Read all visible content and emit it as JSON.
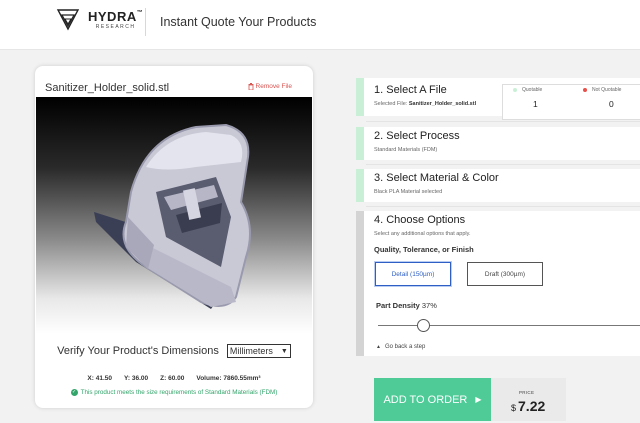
{
  "header": {
    "logo_main": "HYDRA",
    "logo_tm": "™",
    "logo_sub": "RESEARCH",
    "title": "Instant Quote Your Products"
  },
  "file_card": {
    "file_name": "Sanitizer_Holder_solid.stl",
    "remove_label": "Remove File",
    "verify_label": "Verify Your Product's Dimensions",
    "units_selected": "Millimeters",
    "dims": {
      "x_label": "X:",
      "x_value": "41.50",
      "y_label": "Y:",
      "y_value": "36.00",
      "z_label": "Z:",
      "z_value": "60.00",
      "volume_label": "Volume:",
      "volume_value": "7860.55mm³"
    },
    "size_ok_text": "This product meets the size requirements of Standard Materials (FDM)"
  },
  "steps": {
    "step1": {
      "title": "1. Select A File",
      "sub_prefix": "Selected File: ",
      "sub_value": "Sanitizer_Holder_solid.stl"
    },
    "step2": {
      "title": "2. Select Process",
      "sub": "Standard Materials (FDM)"
    },
    "step3": {
      "title": "3. Select Material & Color",
      "sub": "Black PLA Material selected"
    },
    "step4": {
      "title": "4. Choose Options",
      "sub": "Select any additional options that apply.",
      "quality_label": "Quality, Tolerance, or Finish",
      "options": [
        "Detail (150µm)",
        "Draft (300µm)"
      ],
      "selected_option": "Detail (150µm)",
      "density_label": "Part Density",
      "density_value": "37%",
      "density_fraction": 0.37,
      "go_back": "Go back a step"
    }
  },
  "stats": {
    "quotable_label": "Quotable",
    "quotable_value": "1",
    "not_quotable_label": "Not Quotable",
    "not_quotable_value": "0"
  },
  "order": {
    "add_label": "ADD TO ORDER",
    "price_label": "PRICE",
    "currency": "$",
    "price": "7.22"
  },
  "colors": {
    "accent_green": "#4fcb97",
    "step_done": "#c9f0d6",
    "selected_blue": "#2f5fc4",
    "error_red": "#d9534f"
  }
}
